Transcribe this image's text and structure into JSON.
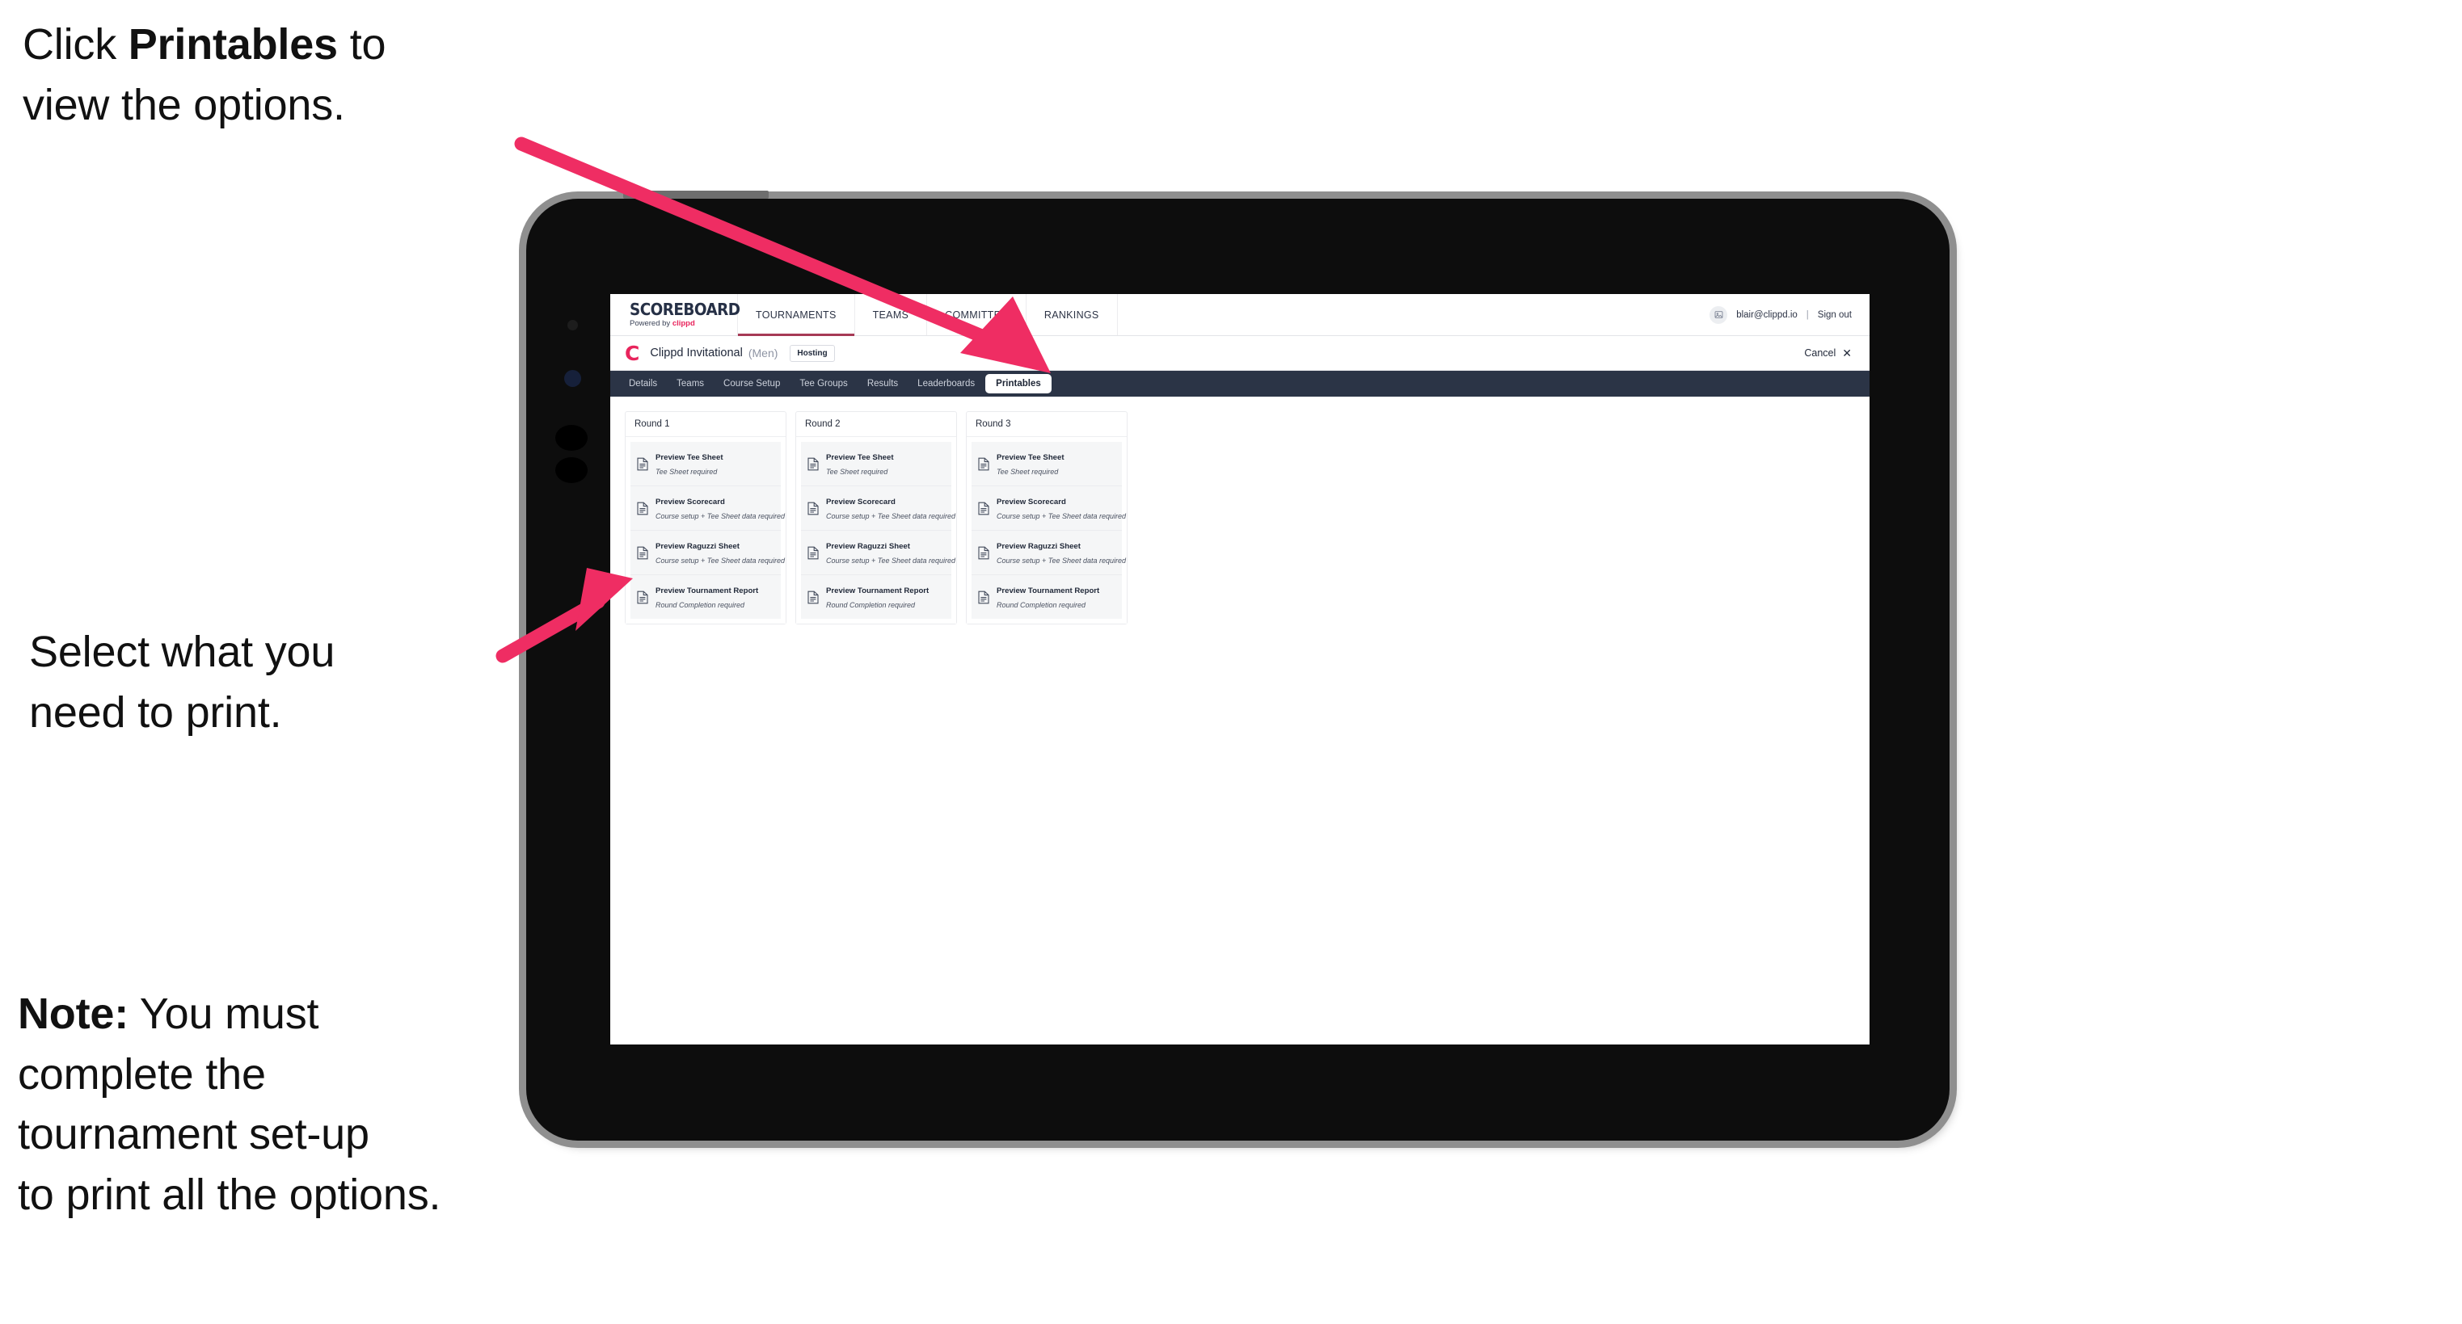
{
  "annotations": {
    "top": "Click Printables to\nview the options.",
    "top_bold_word": "Printables",
    "middle": "Select what you\n need to print.",
    "note_bold": "Note:",
    "note": "Note: You must\ncomplete the\ntournament set-up\nto print all the options."
  },
  "app": {
    "brand": {
      "title": "SCOREBOARD",
      "powered_prefix": "Powered by ",
      "powered_brand": "clippd"
    },
    "top_nav": [
      {
        "label": "TOURNAMENTS",
        "active": true
      },
      {
        "label": "TEAMS",
        "active": false
      },
      {
        "label": "COMMITTEE",
        "active": false
      },
      {
        "label": "RANKINGS",
        "active": false
      }
    ],
    "account": {
      "avatar_icon": "user-image-icon",
      "email": "blair@clippd.io",
      "separator": "|",
      "sign_out": "Sign out"
    },
    "tournament": {
      "logo_letter": "C",
      "name": "Clippd Invitational",
      "gender": "(Men)",
      "badge": "Hosting",
      "cancel_label": "Cancel",
      "cancel_icon": "close-icon"
    },
    "tabs": [
      {
        "label": "Details",
        "active": false
      },
      {
        "label": "Teams",
        "active": false
      },
      {
        "label": "Course Setup",
        "active": false
      },
      {
        "label": "Tee Groups",
        "active": false
      },
      {
        "label": "Results",
        "active": false
      },
      {
        "label": "Leaderboards",
        "active": false
      },
      {
        "label": "Printables",
        "active": true
      }
    ],
    "rounds": [
      {
        "title": "Round 1",
        "items": [
          {
            "icon": "document-icon",
            "title": "Preview Tee Sheet",
            "sub": "Tee Sheet required"
          },
          {
            "icon": "document-icon",
            "title": "Preview Scorecard",
            "sub": "Course setup + Tee Sheet data required"
          },
          {
            "icon": "document-icon",
            "title": "Preview Raguzzi Sheet",
            "sub": "Course setup + Tee Sheet data required"
          },
          {
            "icon": "document-icon",
            "title": "Preview Tournament Report",
            "sub": "Round Completion required"
          }
        ]
      },
      {
        "title": "Round 2",
        "items": [
          {
            "icon": "document-icon",
            "title": "Preview Tee Sheet",
            "sub": "Tee Sheet required"
          },
          {
            "icon": "document-icon",
            "title": "Preview Scorecard",
            "sub": "Course setup + Tee Sheet data required"
          },
          {
            "icon": "document-icon",
            "title": "Preview Raguzzi Sheet",
            "sub": "Course setup + Tee Sheet data required"
          },
          {
            "icon": "document-icon",
            "title": "Preview Tournament Report",
            "sub": "Round Completion required"
          }
        ]
      },
      {
        "title": "Round 3",
        "items": [
          {
            "icon": "document-icon",
            "title": "Preview Tee Sheet",
            "sub": "Tee Sheet required"
          },
          {
            "icon": "document-icon",
            "title": "Preview Scorecard",
            "sub": "Course setup + Tee Sheet data required"
          },
          {
            "icon": "document-icon",
            "title": "Preview Raguzzi Sheet",
            "sub": "Course setup + Tee Sheet data required"
          },
          {
            "icon": "document-icon",
            "title": "Preview Tournament Report",
            "sub": "Round Completion required"
          }
        ]
      }
    ]
  },
  "colors": {
    "accent_pink": "#ef2d63",
    "brand_pink": "#e8245c",
    "nav_dark": "#2b3446",
    "tab_underline": "#a63a55",
    "row_bg": "#f5f6f7",
    "text_dark": "#222a3a"
  }
}
